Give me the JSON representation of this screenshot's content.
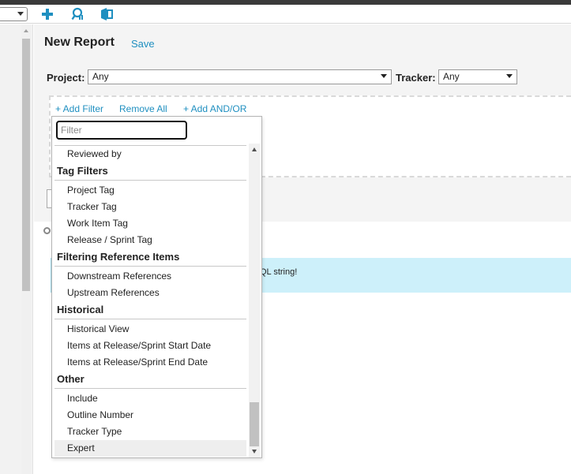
{
  "toolbar": {
    "icons": [
      "plus-icon",
      "report-search-icon",
      "export-icon"
    ],
    "accent_color": "#1f8fc0"
  },
  "report": {
    "title": "New Report",
    "save_label": "Save"
  },
  "filters": {
    "project_label": "Project:",
    "project_value": "Any",
    "tracker_label": "Tracker:",
    "tracker_value": "Any",
    "add_filter": "+ Add Filter",
    "remove_all": "Remove All",
    "add_and_or": "+ Add AND/OR"
  },
  "info": {
    "text": "QL string!",
    "background_color": "#cdf0fa"
  },
  "dropdown": {
    "filter_placeholder": "Filter",
    "items": {
      "reviewed_by": "Reviewed by",
      "tag_filters": "Tag Filters",
      "project_tag": "Project Tag",
      "tracker_tag": "Tracker Tag",
      "work_item_tag": "Work Item Tag",
      "release_sprint_tag": "Release / Sprint Tag",
      "filtering_reference_items": "Filtering Reference Items",
      "downstream_references": "Downstream References",
      "upstream_references": "Upstream References",
      "historical": "Historical",
      "historical_view": "Historical View",
      "items_at_start": "Items at Release/Sprint Start Date",
      "items_at_end": "Items at Release/Sprint End Date",
      "other": "Other",
      "include": "Include",
      "outline_number": "Outline Number",
      "tracker_type": "Tracker Type",
      "expert": "Expert"
    }
  }
}
